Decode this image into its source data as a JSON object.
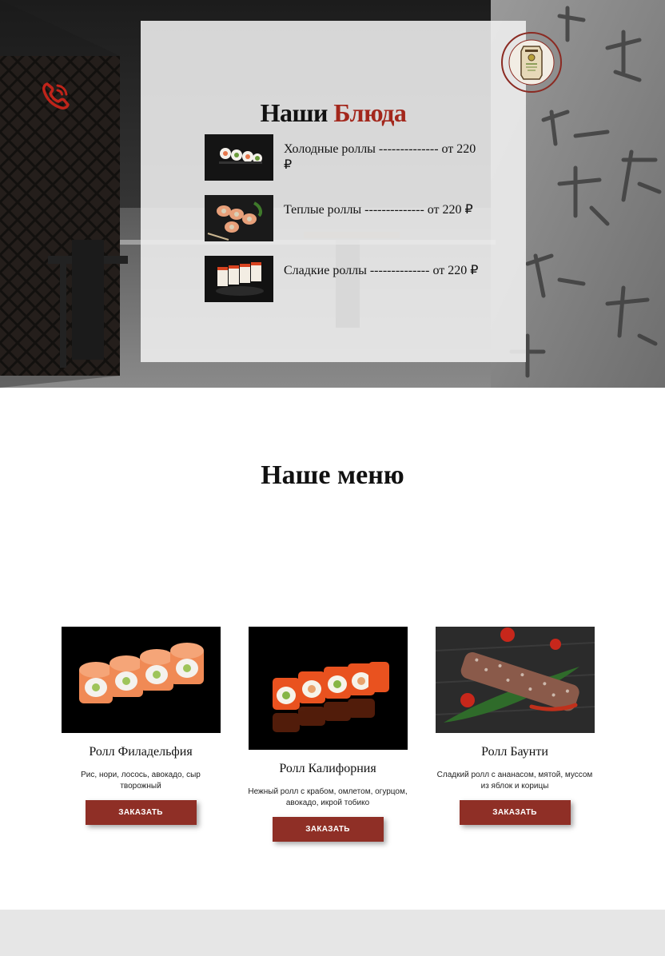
{
  "hero": {
    "phone_icon": "phone-icon",
    "logo_icon": "restaurant-logo-icon",
    "panel": {
      "title_main": "Наши",
      "title_accent": "Блюда",
      "accent_color": "#a3271c",
      "dishes": [
        {
          "text": "Холодные роллы -------------- от 220 ₽"
        },
        {
          "text": "Теплые роллы -------------- от 220 ₽"
        },
        {
          "text": "Сладкие роллы -------------- от 220 ₽"
        }
      ]
    }
  },
  "menu": {
    "title": "Наше меню",
    "button_color": "#8f2f26",
    "items": [
      {
        "name": "Ролл Филадельфия",
        "description": "Рис, нори, лосось, авокадо, сыр творожный",
        "button": "ЗАКАЗАТЬ"
      },
      {
        "name": "Ролл Калифорния",
        "description": "Нежный ролл с крабом, омлетом, огурцом, авокадо, икрой тобико",
        "button": "ЗАКАЗАТЬ"
      },
      {
        "name": "Ролл Баунти",
        "description": "Сладкий ролл с ананасом, мятой, муссом из яблок и корицы",
        "button": "ЗАКАЗАТЬ"
      }
    ]
  }
}
